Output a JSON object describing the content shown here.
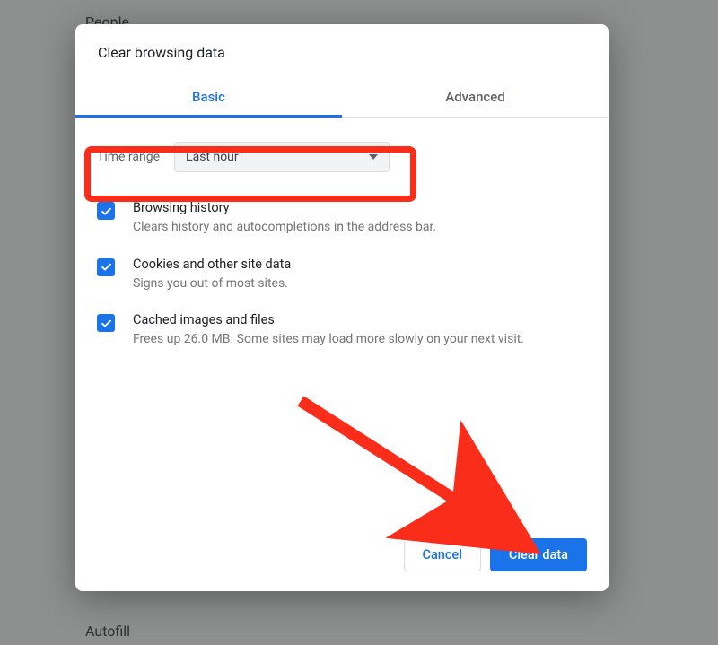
{
  "background": {
    "people_label": "People",
    "autofill_label": "Autofill"
  },
  "dialog": {
    "title": "Clear browsing data",
    "tabs": {
      "basic": "Basic",
      "advanced": "Advanced"
    },
    "time_range": {
      "label": "Time range",
      "selected": "Last hour"
    },
    "options": [
      {
        "title": "Browsing history",
        "desc": "Clears history and autocompletions in the address bar."
      },
      {
        "title": "Cookies and other site data",
        "desc": "Signs you out of most sites."
      },
      {
        "title": "Cached images and files",
        "desc": "Frees up 26.0 MB. Some sites may load more slowly on your next visit."
      }
    ],
    "buttons": {
      "cancel": "Cancel",
      "clear": "Clear data"
    }
  }
}
